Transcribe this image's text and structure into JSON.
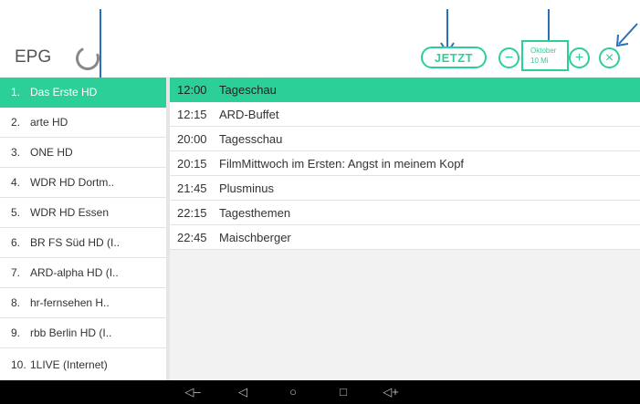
{
  "header": {
    "title": "EPG",
    "now_button": "JETZT",
    "prev_day_symbol": "−",
    "next_day_symbol": "+",
    "close_symbol": "×",
    "date_line1": "Oktober",
    "date_line2": "10 Mi"
  },
  "channels": [
    {
      "num": "1.",
      "name": "Das Erste HD"
    },
    {
      "num": "2.",
      "name": "arte HD"
    },
    {
      "num": "3.",
      "name": "ONE HD"
    },
    {
      "num": "4.",
      "name": "WDR HD Dortm.."
    },
    {
      "num": "5.",
      "name": "WDR HD Essen"
    },
    {
      "num": "6.",
      "name": "BR FS Süd HD (I.."
    },
    {
      "num": "7.",
      "name": "ARD-alpha HD (I.."
    },
    {
      "num": "8.",
      "name": "hr-fernsehen H.."
    },
    {
      "num": "9.",
      "name": "rbb Berlin HD (I.."
    },
    {
      "num": "10.",
      "name": "1LIVE (Internet)"
    }
  ],
  "programs": [
    {
      "time": "12:00",
      "title": "Tageschau"
    },
    {
      "time": "12:15",
      "title": "ARD-Buffet"
    },
    {
      "time": "20:00",
      "title": "Tagesschau"
    },
    {
      "time": "20:15",
      "title": "FilmMittwoch im Ersten: Angst in meinem Kopf"
    },
    {
      "time": "21:45",
      "title": "Plusminus"
    },
    {
      "time": "22:15",
      "title": "Tagesthemen"
    },
    {
      "time": "22:45",
      "title": "Maischberger"
    }
  ],
  "navbar": {
    "volume_down": "◁–",
    "back": "◁",
    "home": "○",
    "recents": "□",
    "volume_up": "◁+"
  },
  "colors": {
    "accent": "#2ccf98",
    "navbar": "#000000",
    "arrow": "#2a6fb8"
  },
  "icons": [
    "loading-spinner-icon",
    "minus-icon",
    "plus-icon",
    "close-icon",
    "back-icon",
    "home-icon",
    "recents-icon",
    "volume-down-icon",
    "volume-up-icon"
  ]
}
